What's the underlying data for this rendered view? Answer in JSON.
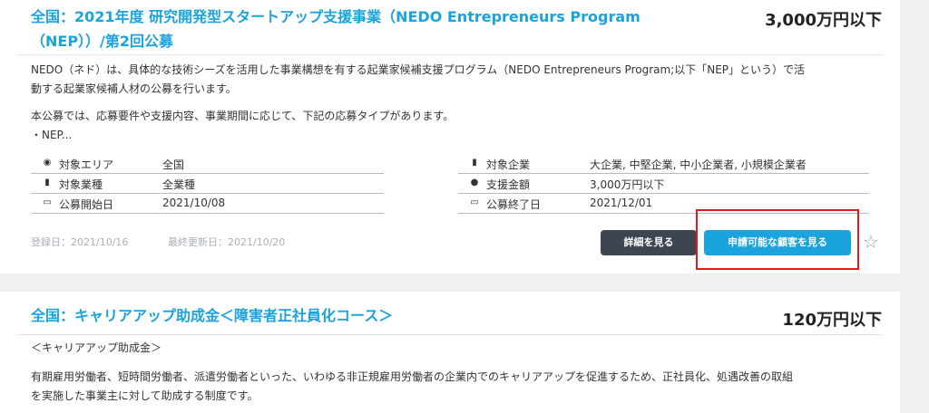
{
  "card1": {
    "title_line1": "全国：2021年度 研究開発型スタートアップ支援事業（NEDO Entrepreneurs Program",
    "title_line2": "（NEP））/第2回公募",
    "amount": "3,000万円以下",
    "desc1_line1": "NEDO（ネド）は、具体的な技術シーズを活用した事業構想を有する起業家候補支援プログラム（NEDO Entrepreneurs Program;以下「NEP」という）で活",
    "desc1_line2": "動する起業家候補人材の公募を行います。",
    "desc2_line1": "本公募では、応募要件や支援内容、事業期間に応じて、下記の応募タイプがあります。",
    "desc2_line2": "・NEP...",
    "info_left": [
      {
        "icon": "pin-icon",
        "glyph": "◉",
        "label": "対象エリア",
        "value": "全国"
      },
      {
        "icon": "building-icon",
        "glyph": "▮",
        "label": "対象業種",
        "value": "全業種"
      },
      {
        "icon": "calendar-icon",
        "glyph": "▭",
        "label": "公募開始日",
        "value": "2021/10/08"
      }
    ],
    "info_right": [
      {
        "icon": "building-icon",
        "glyph": "▮",
        "label": "対象企業",
        "value": "大企業, 中堅企業, 中小企業者, 小規模企業者"
      },
      {
        "icon": "money-bag-icon",
        "glyph": "●",
        "label": "支援金額",
        "value": "3,000万円以下"
      },
      {
        "icon": "calendar-icon",
        "glyph": "▭",
        "label": "公募終了日",
        "value": "2021/12/01"
      }
    ],
    "registered": "登録日：2021/10/16",
    "updated": "最終更新日：2021/10/20",
    "detail_button": "詳細を見る",
    "apply_button": "申請可能な顧客を見る",
    "star_glyph": "☆"
  },
  "card2": {
    "title": "全国：キャリアアップ助成金＜障害者正社員化コース＞",
    "amount": "120万円以下",
    "line1": "＜キャリアアップ助成金＞",
    "line2": "有期雇用労働者、短時間労働者、派遣労働者といった、いわゆる非正規雇用労働者の企業内でのキャリアアップを促進するため、正社員化、処遇改善の取組",
    "line3": "を実施した事業主に対して助成する制度です。"
  },
  "colors": {
    "accent": "#1aa3dd",
    "dark_button": "#3d4650",
    "highlight": "#e01a1a"
  }
}
